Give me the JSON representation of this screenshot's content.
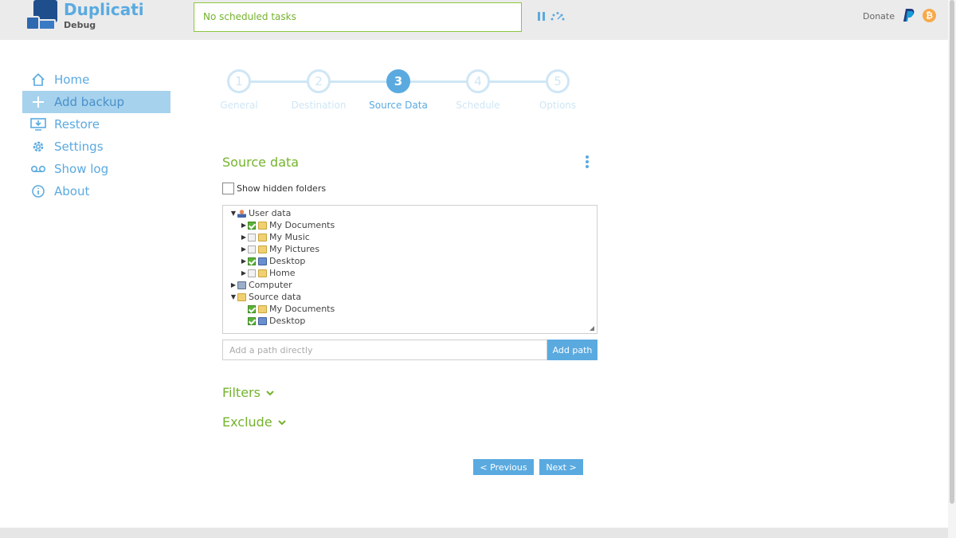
{
  "app": {
    "title": "Duplicati",
    "subtitle": "Debug"
  },
  "status": {
    "text": "No scheduled tasks"
  },
  "header": {
    "donate_label": "Donate",
    "bitcoin_symbol": "₿"
  },
  "sidebar": {
    "items": [
      {
        "label": "Home",
        "icon": "home-icon",
        "active": false
      },
      {
        "label": "Add backup",
        "icon": "plus-icon",
        "active": true
      },
      {
        "label": "Restore",
        "icon": "restore-icon",
        "active": false
      },
      {
        "label": "Settings",
        "icon": "gear-icon",
        "active": false
      },
      {
        "label": "Show log",
        "icon": "log-icon",
        "active": false
      },
      {
        "label": "About",
        "icon": "info-icon",
        "active": false
      }
    ]
  },
  "wizard": {
    "steps": [
      {
        "number": "1",
        "label": "General",
        "active": false
      },
      {
        "number": "2",
        "label": "Destination",
        "active": false
      },
      {
        "number": "3",
        "label": "Source Data",
        "active": true
      },
      {
        "number": "4",
        "label": "Schedule",
        "active": false
      },
      {
        "number": "5",
        "label": "Options",
        "active": false
      }
    ]
  },
  "source": {
    "title": "Source data",
    "show_hidden_label": "Show hidden folders",
    "tree": [
      {
        "label": "User data",
        "arrow": "down",
        "checkbox": null,
        "icon": "user-icon"
      },
      {
        "label": "My Documents",
        "arrow": "right",
        "checkbox": true,
        "icon": "folder-icon"
      },
      {
        "label": "My Music",
        "arrow": "right",
        "checkbox": false,
        "icon": "music-folder-icon"
      },
      {
        "label": "My Pictures",
        "arrow": "right",
        "checkbox": false,
        "icon": "pictures-folder-icon"
      },
      {
        "label": "Desktop",
        "arrow": "right",
        "checkbox": true,
        "icon": "desktop-icon"
      },
      {
        "label": "Home",
        "arrow": "right",
        "checkbox": false,
        "icon": "home-folder-icon"
      },
      {
        "label": "Computer",
        "arrow": "right",
        "checkbox": null,
        "icon": "computer-icon"
      },
      {
        "label": "Source data",
        "arrow": "down",
        "checkbox": null,
        "icon": "folder-icon"
      },
      {
        "label": "My Documents",
        "arrow": null,
        "checkbox": true,
        "icon": "folder-icon"
      },
      {
        "label": "Desktop",
        "arrow": null,
        "checkbox": true,
        "icon": "desktop-icon"
      }
    ],
    "path_placeholder": "Add a path directly",
    "add_path_label": "Add path",
    "filters_label": "Filters",
    "exclude_label": "Exclude"
  },
  "nav": {
    "previous_label": "< Previous",
    "next_label": "Next >"
  },
  "colors": {
    "accent_blue": "#5aaae0",
    "accent_green": "#74b32d",
    "active_nav": "#a6d2ee"
  }
}
